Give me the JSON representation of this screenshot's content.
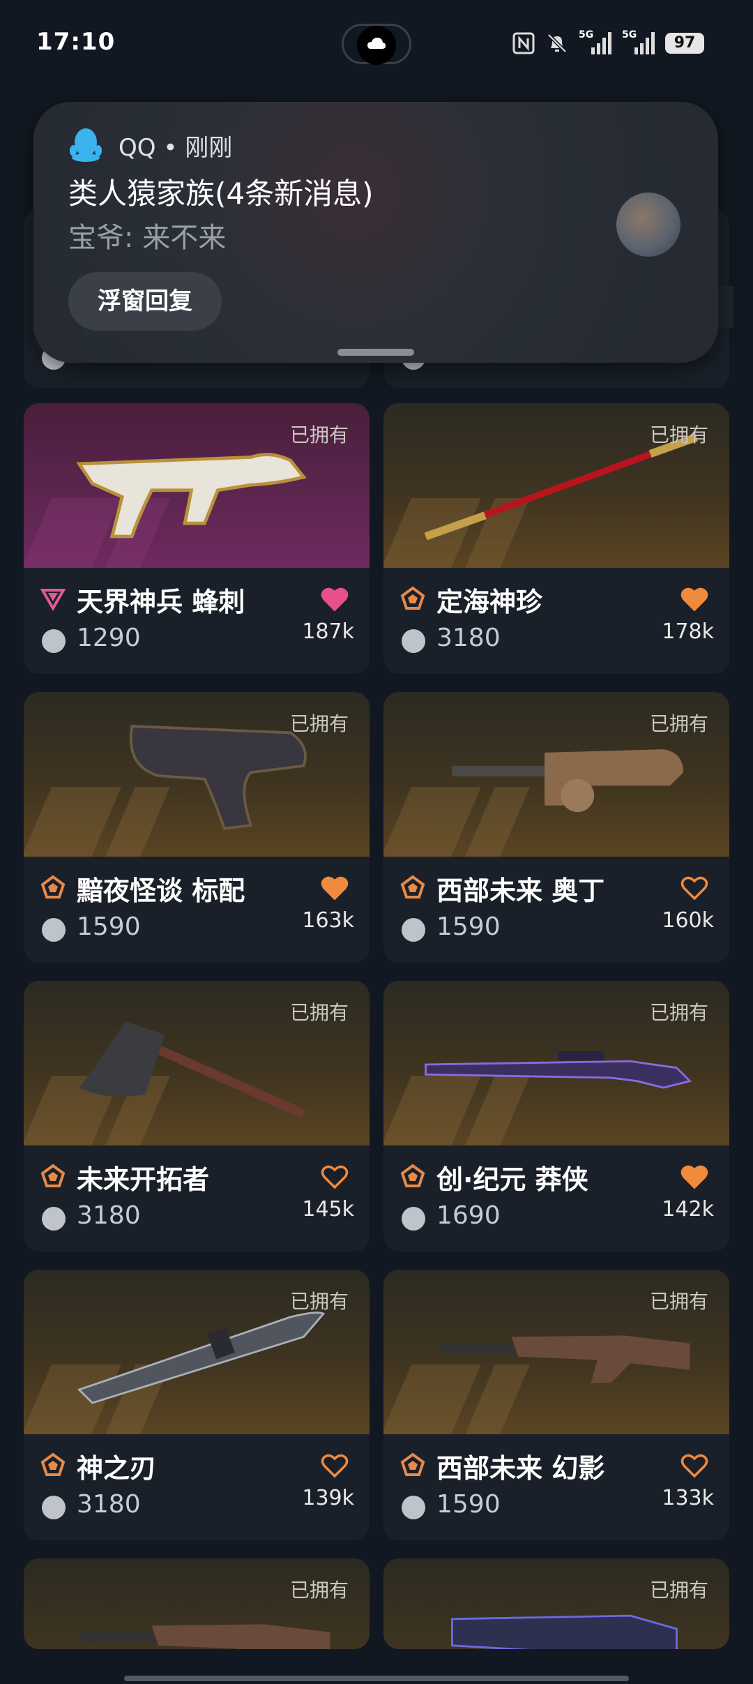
{
  "status_bar": {
    "time": "17:10",
    "network_1": "5G",
    "network_2": "5G",
    "battery": "97"
  },
  "notification": {
    "app": "QQ • 刚刚",
    "title": "类人猿家族(4条新消息)",
    "body": "宝爷: 来不来",
    "reply_button": "浮窗回复"
  },
  "owned_label": "已拥有",
  "colors": {
    "heart_pink": "#e8508a",
    "heart_orange": "#f08a3c",
    "tier_pink": "#e05a9a",
    "tier_orange": "#e8894a"
  },
  "cards": [
    {
      "name": "天界神兵 蜂刺",
      "price": "1290",
      "likes": "187k",
      "tier": "pink",
      "heart": "filled-pink",
      "weapon": "smg-icon"
    },
    {
      "name": "定海神珍",
      "price": "3180",
      "likes": "178k",
      "tier": "orange",
      "heart": "filled-orange",
      "weapon": "staff-icon"
    },
    {
      "name": "黯夜怪谈 标配",
      "price": "1590",
      "likes": "163k",
      "tier": "orange",
      "heart": "filled-orange",
      "weapon": "pistol-icon"
    },
    {
      "name": "西部未来 奥丁",
      "price": "1590",
      "likes": "160k",
      "tier": "orange",
      "heart": "outline",
      "weapon": "machinegun-icon"
    },
    {
      "name": "未来开拓者",
      "price": "3180",
      "likes": "145k",
      "tier": "orange",
      "heart": "outline",
      "weapon": "axe-icon"
    },
    {
      "name": "创·纪元 莽侠",
      "price": "1690",
      "likes": "142k",
      "tier": "orange",
      "heart": "filled-orange",
      "weapon": "sniper-icon"
    },
    {
      "name": "神之刃",
      "price": "3180",
      "likes": "139k",
      "tier": "orange",
      "heart": "outline",
      "weapon": "knife-icon"
    },
    {
      "name": "西部未来 幻影",
      "price": "1590",
      "likes": "133k",
      "tier": "orange",
      "heart": "outline",
      "weapon": "rifle-icon"
    },
    {
      "name": "",
      "price": "",
      "likes": "",
      "tier": "orange",
      "heart": "none",
      "weapon": "rifle-icon"
    },
    {
      "name": "",
      "price": "",
      "likes": "",
      "tier": "orange",
      "heart": "none",
      "weapon": "shotgun-icon"
    }
  ]
}
